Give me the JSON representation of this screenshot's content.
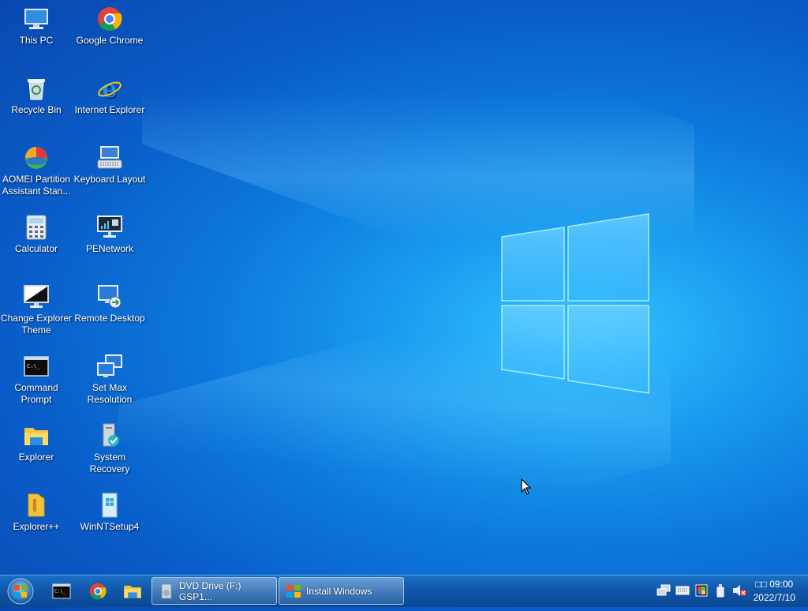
{
  "desktop": {
    "icons": [
      {
        "label": "This PC",
        "icon": "this-pc-icon"
      },
      {
        "label": "Google Chrome",
        "icon": "chrome-icon"
      },
      {
        "label": "Recycle Bin",
        "icon": "recycle-bin-icon"
      },
      {
        "label": "Internet Explorer",
        "icon": "internet-explorer-icon"
      },
      {
        "label": "AOMEI Partition Assistant Stan...",
        "icon": "aomei-partition-icon"
      },
      {
        "label": "Keyboard Layout",
        "icon": "keyboard-layout-icon"
      },
      {
        "label": "Calculator",
        "icon": "calculator-icon"
      },
      {
        "label": "PENetwork",
        "icon": "penetwork-icon"
      },
      {
        "label": "Change Explorer Theme",
        "icon": "change-theme-icon"
      },
      {
        "label": "Remote Desktop",
        "icon": "remote-desktop-icon"
      },
      {
        "label": "Command Prompt",
        "icon": "command-prompt-icon"
      },
      {
        "label": "Set Max Resolution",
        "icon": "set-resolution-icon"
      },
      {
        "label": "Explorer",
        "icon": "explorer-icon"
      },
      {
        "label": "System Recovery",
        "icon": "system-recovery-icon"
      },
      {
        "label": "Explorer++",
        "icon": "explorer-plus-icon"
      },
      {
        "label": "WinNTSetup4",
        "icon": "winntsetup-icon"
      }
    ]
  },
  "taskbar": {
    "start": {
      "icon": "windows-start-icon"
    },
    "pinned": [
      {
        "icon": "command-prompt-icon"
      },
      {
        "icon": "chrome-icon"
      },
      {
        "icon": "folder-icon"
      }
    ],
    "tasks": [
      {
        "label": "DVD Drive (F:) GSP1...",
        "icon": "dvd-drive-icon"
      },
      {
        "label": "Install Windows",
        "icon": "windows-setup-icon"
      }
    ],
    "tray": [
      {
        "icon": "network-icon"
      },
      {
        "icon": "keyboard-icon"
      },
      {
        "icon": "color-display-icon"
      },
      {
        "icon": "usb-drive-icon"
      },
      {
        "icon": "volume-muted-icon"
      }
    ],
    "clock": {
      "time": "□□ 09:00",
      "date": "2022/7/10"
    }
  },
  "colors": {
    "desktop_blue": "#0c79dd",
    "taskbar_blue": "#0f55a8",
    "logo_glow": "#8fe0ff"
  }
}
